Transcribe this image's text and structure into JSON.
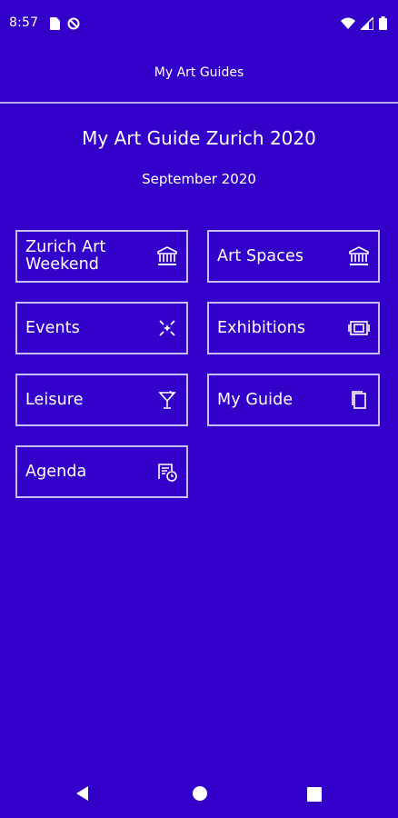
{
  "status_bar": {
    "time": "8:57",
    "left_icons": [
      "sim-card-icon",
      "no-sync-icon"
    ],
    "right_icons": [
      "wifi-icon",
      "signal-icon",
      "battery-icon"
    ]
  },
  "app_bar": {
    "title": "My Art Guides"
  },
  "guide": {
    "title": "My Art Guide Zurich 2020",
    "date": "September 2020"
  },
  "tiles": [
    {
      "label": "Zurich Art\nWeekend",
      "icon": "museum-icon"
    },
    {
      "label": "Art Spaces",
      "icon": "museum-icon"
    },
    {
      "label": "Events",
      "icon": "sparkle-icon"
    },
    {
      "label": "Exhibitions",
      "icon": "exhibition-frame-icon"
    },
    {
      "label": "Leisure",
      "icon": "cocktail-icon"
    },
    {
      "label": "My Guide",
      "icon": "bookmark-pages-icon"
    },
    {
      "label": "Agenda",
      "icon": "calendar-clock-icon"
    }
  ],
  "nav_bar": {
    "icons": [
      "back-triangle-icon",
      "home-circle-icon",
      "recents-square-icon"
    ]
  },
  "colors": {
    "background": "#3200c8",
    "text": "#ffffff",
    "border": "#c7bdf3"
  }
}
